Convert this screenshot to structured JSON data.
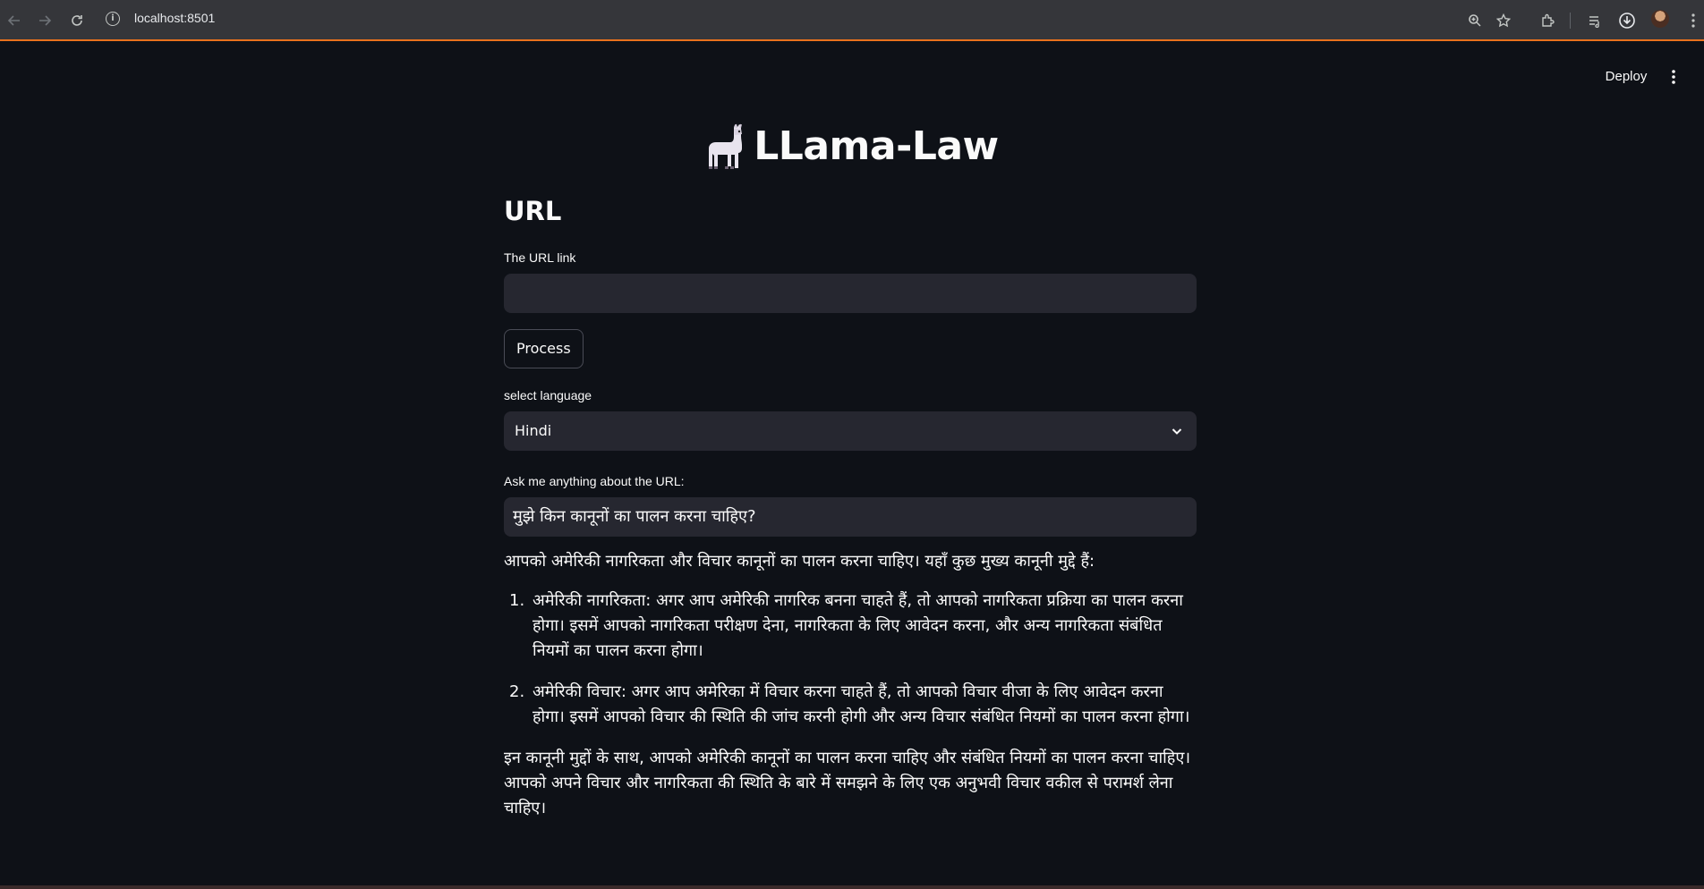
{
  "browser": {
    "url": "localhost:8501",
    "icons": {
      "back": "arrow-left-icon",
      "forward": "arrow-right-icon",
      "reload": "reload-icon",
      "info": "info-icon",
      "zoom": "zoom-icon",
      "bookmark": "star-icon",
      "extensions": "puzzle-icon",
      "media": "media-queue-icon",
      "download": "download-icon",
      "profile": "avatar",
      "menu": "kebab-menu-icon"
    }
  },
  "header": {
    "deploy_label": "Deploy"
  },
  "app": {
    "title": "LLama-Law",
    "title_icon": "llama-icon",
    "url_heading": "URL",
    "url_label": "The URL link",
    "url_value": "",
    "process_label": "Process",
    "language_label": "select language",
    "language_value": "Hindi",
    "ask_label": "Ask me anything about the URL:",
    "ask_value": "मुझे किन कानूनों का पालन करना चाहिए?"
  },
  "answer": {
    "intro": "आपको अमेरिकी नागरिकता और विचार कानूनों का पालन करना चाहिए। यहाँ कुछ मुख्य कानूनी मुद्दे हैं:",
    "items": [
      {
        "num": "1.",
        "text": "अमेरिकी नागरिकता: अगर आप अमेरिकी नागरिक बनना चाहते हैं, तो आपको नागरिकता प्रक्रिया का पालन करना होगा। इसमें आपको नागरिकता परीक्षण देना, नागरिकता के लिए आवेदन करना, और अन्य नागरिकता संबंधित नियमों का पालन करना होगा।"
      },
      {
        "num": "2.",
        "text": "अमेरिकी विचार: अगर आप अमेरिका में विचार करना चाहते हैं, तो आपको विचार वीजा के लिए आवेदन करना होगा। इसमें आपको विचार की स्थिति की जांच करनी होगी और अन्य विचार संबंधित नियमों का पालन करना होगा।"
      }
    ],
    "conclusion": "इन कानूनी मुद्दों के साथ, आपको अमेरिकी कानूनों का पालन करना चाहिए और संबंधित नियमों का पालन करना चाहिए। आपको अपने विचार और नागरिकता की स्थिति के बारे में समझने के लिए एक अनुभवी विचार वकील से परामर्श लेना चाहिए।"
  }
}
